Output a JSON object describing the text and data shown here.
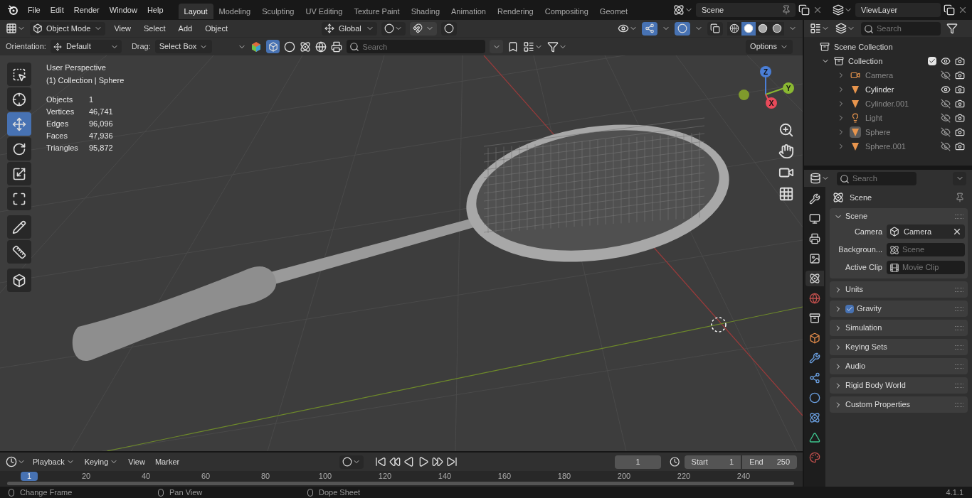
{
  "topbar": {
    "menus": [
      "File",
      "Edit",
      "Render",
      "Window",
      "Help"
    ],
    "workspaces": [
      {
        "label": "Layout",
        "selected": true
      },
      {
        "label": "Modeling",
        "selected": false
      },
      {
        "label": "Sculpting",
        "selected": false
      },
      {
        "label": "UV Editing",
        "selected": false
      },
      {
        "label": "Texture Paint",
        "selected": false
      },
      {
        "label": "Shading",
        "selected": false
      },
      {
        "label": "Animation",
        "selected": false
      },
      {
        "label": "Rendering",
        "selected": false
      },
      {
        "label": "Compositing",
        "selected": false
      },
      {
        "label": "Geomet",
        "selected": false
      }
    ],
    "scene": "Scene",
    "view_layer": "ViewLayer"
  },
  "viewport_header": {
    "mode": "Object Mode",
    "menus": [
      "View",
      "Select",
      "Add",
      "Object"
    ],
    "transform_orientation": "Global",
    "shading": [
      {
        "kind": "wireframe",
        "selected": false
      },
      {
        "kind": "solid",
        "selected": true
      },
      {
        "kind": "material",
        "selected": false
      },
      {
        "kind": "rendered",
        "selected": false
      }
    ]
  },
  "tool_settings": {
    "orientation_label": "Orientation:",
    "orientation": "Default",
    "drag_label": "Drag:",
    "drag": "Select Box",
    "search_placeholder": "Search",
    "options": "Options"
  },
  "toolbar": [
    {
      "selected": false
    },
    {
      "selected": false
    },
    {
      "selected": true
    },
    {
      "selected": false
    },
    {
      "selected": false
    },
    {
      "selected": false
    },
    {
      "selected": false
    },
    {
      "selected": false
    },
    {
      "selected": false
    }
  ],
  "viewport": {
    "title": "User Perspective",
    "subtitle": "(1) Collection | Sphere",
    "stats": [
      {
        "label": "Objects",
        "value": "1"
      },
      {
        "label": "Vertices",
        "value": "46,741"
      },
      {
        "label": "Edges",
        "value": "96,096"
      },
      {
        "label": "Faces",
        "value": "47,936"
      },
      {
        "label": "Triangles",
        "value": "95,872"
      }
    ],
    "gizmo_axes": [
      "Z",
      "Y",
      "X"
    ]
  },
  "outliner": {
    "search_placeholder": "Search",
    "scene_collection": "Scene Collection",
    "collection": {
      "name": "Collection",
      "checked": true,
      "expanded": true,
      "children": [
        {
          "name": "Camera",
          "kind": "camera",
          "visible": false,
          "active": false
        },
        {
          "name": "Cylinder",
          "kind": "mesh",
          "visible": true,
          "active": false
        },
        {
          "name": "Cylinder.001",
          "kind": "mesh",
          "visible": false,
          "active": false
        },
        {
          "name": "Light",
          "kind": "light",
          "visible": false,
          "active": false
        },
        {
          "name": "Sphere",
          "kind": "mesh",
          "visible": false,
          "active": true
        },
        {
          "name": "Sphere.001",
          "kind": "mesh",
          "visible": false,
          "active": false
        }
      ]
    }
  },
  "properties": {
    "search_placeholder": "Search",
    "context": "Scene",
    "tabs": [
      {
        "selected": false
      },
      {
        "selected": false
      },
      {
        "selected": false
      },
      {
        "selected": false
      },
      {
        "selected": true
      },
      {
        "selected": false
      },
      {
        "selected": false
      },
      {
        "selected": false
      },
      {
        "selected": false
      },
      {
        "selected": false
      },
      {
        "selected": false
      },
      {
        "selected": false
      },
      {
        "selected": false
      },
      {
        "selected": false
      }
    ],
    "panels": [
      {
        "title": "Scene",
        "expanded": true,
        "fields": [
          {
            "label": "Camera",
            "value": "Camera"
          },
          {
            "label": "Backgroun...",
            "placeholder": "Scene"
          },
          {
            "label": "Active Clip",
            "placeholder": "Movie Clip"
          }
        ]
      },
      {
        "title": "Units",
        "expanded": false
      },
      {
        "title": "Gravity",
        "expanded": false,
        "checked": true
      },
      {
        "title": "Simulation",
        "expanded": false
      },
      {
        "title": "Keying Sets",
        "expanded": false
      },
      {
        "title": "Audio",
        "expanded": false
      },
      {
        "title": "Rigid Body World",
        "expanded": false
      },
      {
        "title": "Custom Properties",
        "expanded": false
      }
    ]
  },
  "timeline": {
    "menus": [
      "Playback",
      "Keying",
      "View",
      "Marker"
    ],
    "current_frame": "1",
    "start_label": "Start",
    "start": "1",
    "end_label": "End",
    "end": "250",
    "playhead": "1",
    "ticks": [
      "20",
      "40",
      "60",
      "80",
      "100",
      "120",
      "140",
      "160",
      "180",
      "200",
      "220",
      "240"
    ]
  },
  "status_bar": {
    "hints": [
      "Change Frame",
      "Pan View",
      "Dope Sheet"
    ],
    "version": "4.1.1"
  }
}
